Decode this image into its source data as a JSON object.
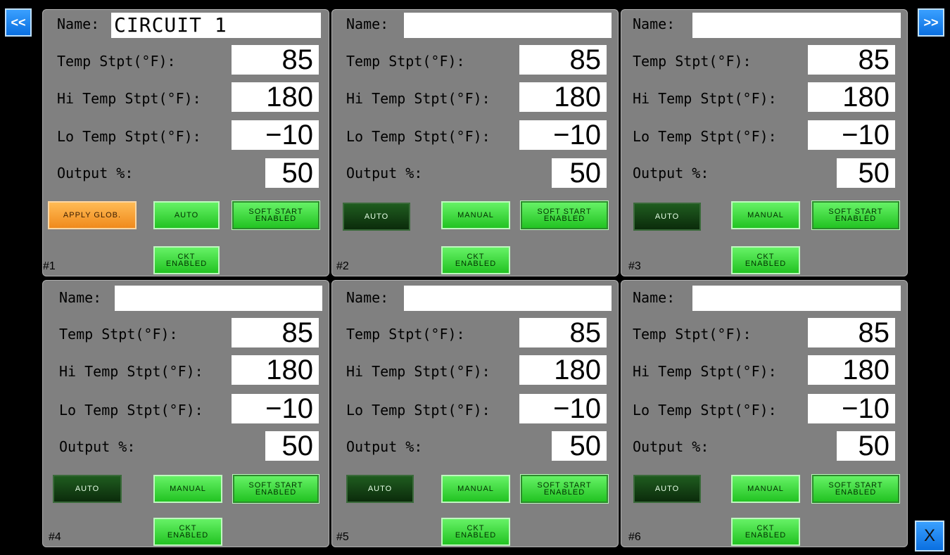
{
  "nav": {
    "prev_label": "<<",
    "next_label": ">>",
    "close_label": "X"
  },
  "panels": [
    {
      "number": "#1",
      "name_label": "Name:",
      "name_value": "CIRCUIT 1",
      "temp_label": "Temp Stpt(°F):",
      "temp_value": "85",
      "hi_label": "Hi Temp Stpt(°F):",
      "hi_value": "180",
      "lo_label": "Lo Temp Stpt(°F):",
      "lo_value": "−10",
      "output_label": "Output %:",
      "output_value": "50",
      "btn1_label": "APPLY GLOB.",
      "btn2_label": "AUTO",
      "soft_start_label": "SOFT START\nENABLED",
      "ckt_label": "CKT\nENABLED"
    },
    {
      "number": "#2",
      "name_label": "Name:",
      "name_value": "",
      "temp_label": "Temp Stpt(°F):",
      "temp_value": "85",
      "hi_label": "Hi Temp Stpt(°F):",
      "hi_value": "180",
      "lo_label": "Lo Temp Stpt(°F):",
      "lo_value": "−10",
      "output_label": "Output %:",
      "output_value": "50",
      "btn1_label": "AUTO",
      "btn2_label": "MANUAL",
      "soft_start_label": "SOFT START\nENABLED",
      "ckt_label": "CKT\nENABLED"
    },
    {
      "number": "#3",
      "name_label": "Name:",
      "name_value": "",
      "temp_label": "Temp Stpt(°F):",
      "temp_value": "85",
      "hi_label": "Hi Temp Stpt(°F):",
      "hi_value": "180",
      "lo_label": "Lo Temp Stpt(°F):",
      "lo_value": "−10",
      "output_label": "Output %:",
      "output_value": "50",
      "btn1_label": "AUTO",
      "btn2_label": "MANUAL",
      "soft_start_label": "SOFT START\nENABLED",
      "ckt_label": "CKT\nENABLED"
    },
    {
      "number": "#4",
      "name_label": "Name:",
      "name_value": "",
      "temp_label": "Temp Stpt(°F):",
      "temp_value": "85",
      "hi_label": "Hi Temp Stpt(°F):",
      "hi_value": "180",
      "lo_label": "Lo Temp Stpt(°F):",
      "lo_value": "−10",
      "output_label": "Output %:",
      "output_value": "50",
      "btn1_label": "AUTO",
      "btn2_label": "MANUAL",
      "soft_start_label": "SOFT START\nENABLED",
      "ckt_label": "CKT\nENABLED"
    },
    {
      "number": "#5",
      "name_label": "Name:",
      "name_value": "",
      "temp_label": "Temp Stpt(°F):",
      "temp_value": "85",
      "hi_label": "Hi Temp Stpt(°F):",
      "hi_value": "180",
      "lo_label": "Lo Temp Stpt(°F):",
      "lo_value": "−10",
      "output_label": "Output %:",
      "output_value": "50",
      "btn1_label": "AUTO",
      "btn2_label": "MANUAL",
      "soft_start_label": "SOFT START\nENABLED",
      "ckt_label": "CKT\nENABLED"
    },
    {
      "number": "#6",
      "name_label": "Name:",
      "name_value": "",
      "temp_label": "Temp Stpt(°F):",
      "temp_value": "85",
      "hi_label": "Hi Temp Stpt(°F):",
      "hi_value": "180",
      "lo_label": "Lo Temp Stpt(°F):",
      "lo_value": "−10",
      "output_label": "Output %:",
      "output_value": "50",
      "btn1_label": "AUTO",
      "btn2_label": "MANUAL",
      "soft_start_label": "SOFT START\nENABLED",
      "ckt_label": "CKT\nENABLED"
    }
  ]
}
